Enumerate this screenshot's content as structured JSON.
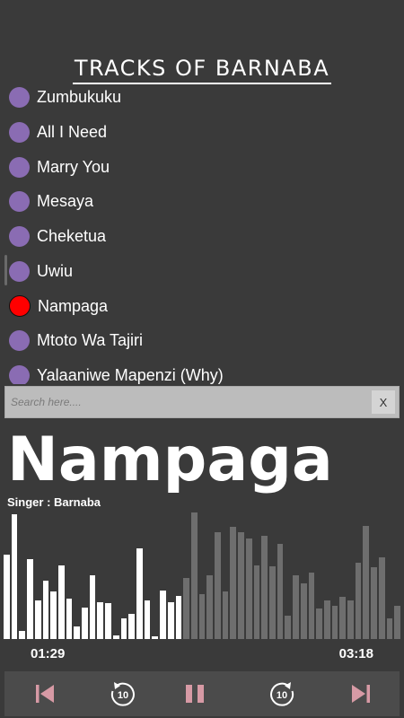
{
  "header": {
    "title": "TRACKS OF BARNABA"
  },
  "tracks": [
    {
      "label": "Zumbukuku",
      "active": false
    },
    {
      "label": "All I Need",
      "active": false
    },
    {
      "label": "Marry You",
      "active": false
    },
    {
      "label": "Mesaya",
      "active": false
    },
    {
      "label": "Cheketua",
      "active": false
    },
    {
      "label": "Uwiu",
      "active": false
    },
    {
      "label": "Nampaga",
      "active": true
    },
    {
      "label": "Mtoto Wa Tajiri",
      "active": false
    },
    {
      "label": "Yalaaniwe Mapenzi (Why)",
      "active": false
    }
  ],
  "search": {
    "placeholder": "Search here....",
    "value": "",
    "clear_label": "X"
  },
  "now_playing": {
    "title": "Nampaga",
    "singer": "Singer : Barnaba",
    "current_time": "01:29",
    "duration": "03:18",
    "progress": 0.45
  },
  "waveform": {
    "levels": [
      0.66,
      0.98,
      0.06,
      0.63,
      0.3,
      0.46,
      0.37,
      0.58,
      0.32,
      0.1,
      0.25,
      0.5,
      0.29,
      0.28,
      0.03,
      0.16,
      0.2,
      0.71,
      0.3,
      0.02,
      0.38,
      0.29,
      0.34,
      0.48,
      0.99,
      0.35,
      0.5,
      0.84,
      0.37,
      0.88,
      0.84,
      0.79,
      0.58,
      0.81,
      0.57,
      0.75,
      0.18,
      0.5,
      0.44,
      0.52,
      0.24,
      0.3,
      0.26,
      0.33,
      0.3,
      0.6,
      0.89,
      0.56,
      0.64,
      0.16,
      0.26
    ],
    "played_color": "#ffffff",
    "unplayed_color": "#6e6e6e"
  },
  "controls": {
    "skip_prev_icon": "skip-previous-icon",
    "rewind_icon": "rewind-10-icon",
    "pause_icon": "pause-icon",
    "forward_icon": "forward-10-icon",
    "skip_next_icon": "skip-next-icon",
    "rewind_seconds": "10",
    "forward_seconds": "10"
  },
  "colors": {
    "background": "#3a3a3a",
    "track_dot": "#8a6cb3",
    "active_dot": "#ff0000",
    "control_icon": "#d79aa5"
  }
}
